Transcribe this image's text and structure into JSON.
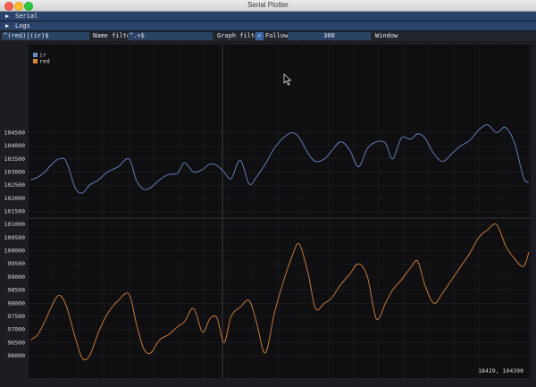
{
  "window": {
    "title": "Serial Plotter"
  },
  "sections": [
    {
      "label": "Serial"
    },
    {
      "label": "Logs"
    }
  ],
  "filters": {
    "regex_value": "^(red)|(ir)$",
    "name_filter_label": "Name filter",
    "name_filter_value": "^.+$",
    "graph_filter_label": "Graph filter",
    "follow_label": "Follow",
    "window_value": "300",
    "window_label": "Window"
  },
  "colors": {
    "ir": "#6f86c5",
    "red": "#d8843a",
    "accent": "#29436b"
  },
  "plot": {
    "cursor_readout": "18429, 104390"
  },
  "chart_data": {
    "type": "line",
    "ylim": [
      95800,
      104800
    ],
    "ticks": [
      "104500",
      "104000",
      "103500",
      "103000",
      "102500",
      "102000",
      "101500",
      "101000",
      "100500",
      "100000",
      "99500",
      "99000",
      "98500",
      "98000",
      "97500",
      "97000",
      "96500",
      "96000"
    ],
    "tick_values": [
      104500,
      104000,
      103500,
      103000,
      102500,
      102000,
      101500,
      101000,
      100500,
      100000,
      99500,
      99000,
      98500,
      98000,
      97500,
      97000,
      96500,
      96000
    ],
    "x": [
      0,
      8,
      16,
      24,
      32,
      40,
      50,
      58,
      66,
      76,
      86,
      98,
      110,
      118,
      126,
      134,
      144,
      154,
      164,
      172,
      182,
      192,
      200,
      208,
      216,
      224,
      234,
      244,
      252,
      262,
      272,
      282,
      292,
      300,
      310,
      318,
      328,
      336,
      346,
      356,
      366,
      376,
      386,
      396,
      404,
      414,
      424,
      432,
      440,
      450,
      460,
      470,
      480,
      490,
      500,
      510,
      520,
      530,
      540,
      550,
      556
    ],
    "series": [
      {
        "name": "ir",
        "values": [
          102700,
          102800,
          103000,
          103300,
          103500,
          103400,
          102400,
          102200,
          102500,
          102700,
          103000,
          103200,
          103500,
          102700,
          102350,
          102400,
          102700,
          102900,
          102950,
          103350,
          103000,
          103100,
          103300,
          103250,
          103000,
          102750,
          103450,
          102550,
          102800,
          103300,
          103900,
          104300,
          104500,
          104300,
          103700,
          103400,
          103500,
          103800,
          104150,
          103850,
          103200,
          103900,
          104150,
          104100,
          103500,
          104300,
          104250,
          104450,
          104300,
          103700,
          103400,
          103700,
          104000,
          104200,
          104600,
          104800,
          104500,
          104700,
          104100,
          102800,
          102600
        ]
      },
      {
        "name": "red",
        "values": [
          96600,
          96800,
          97300,
          97900,
          98300,
          97900,
          96700,
          95900,
          96000,
          96900,
          97600,
          98100,
          98350,
          97250,
          96300,
          96100,
          96600,
          96800,
          97100,
          97300,
          97800,
          96900,
          97400,
          97450,
          96500,
          97500,
          97850,
          98100,
          97300,
          96100,
          97600,
          98800,
          99800,
          100250,
          99100,
          97800,
          98000,
          98200,
          98700,
          99100,
          99500,
          99000,
          97400,
          98000,
          98500,
          98900,
          99350,
          99600,
          98700,
          98000,
          98400,
          98900,
          99400,
          99900,
          100500,
          100800,
          101000,
          100200,
          99700,
          99400,
          99950
        ]
      }
    ]
  }
}
